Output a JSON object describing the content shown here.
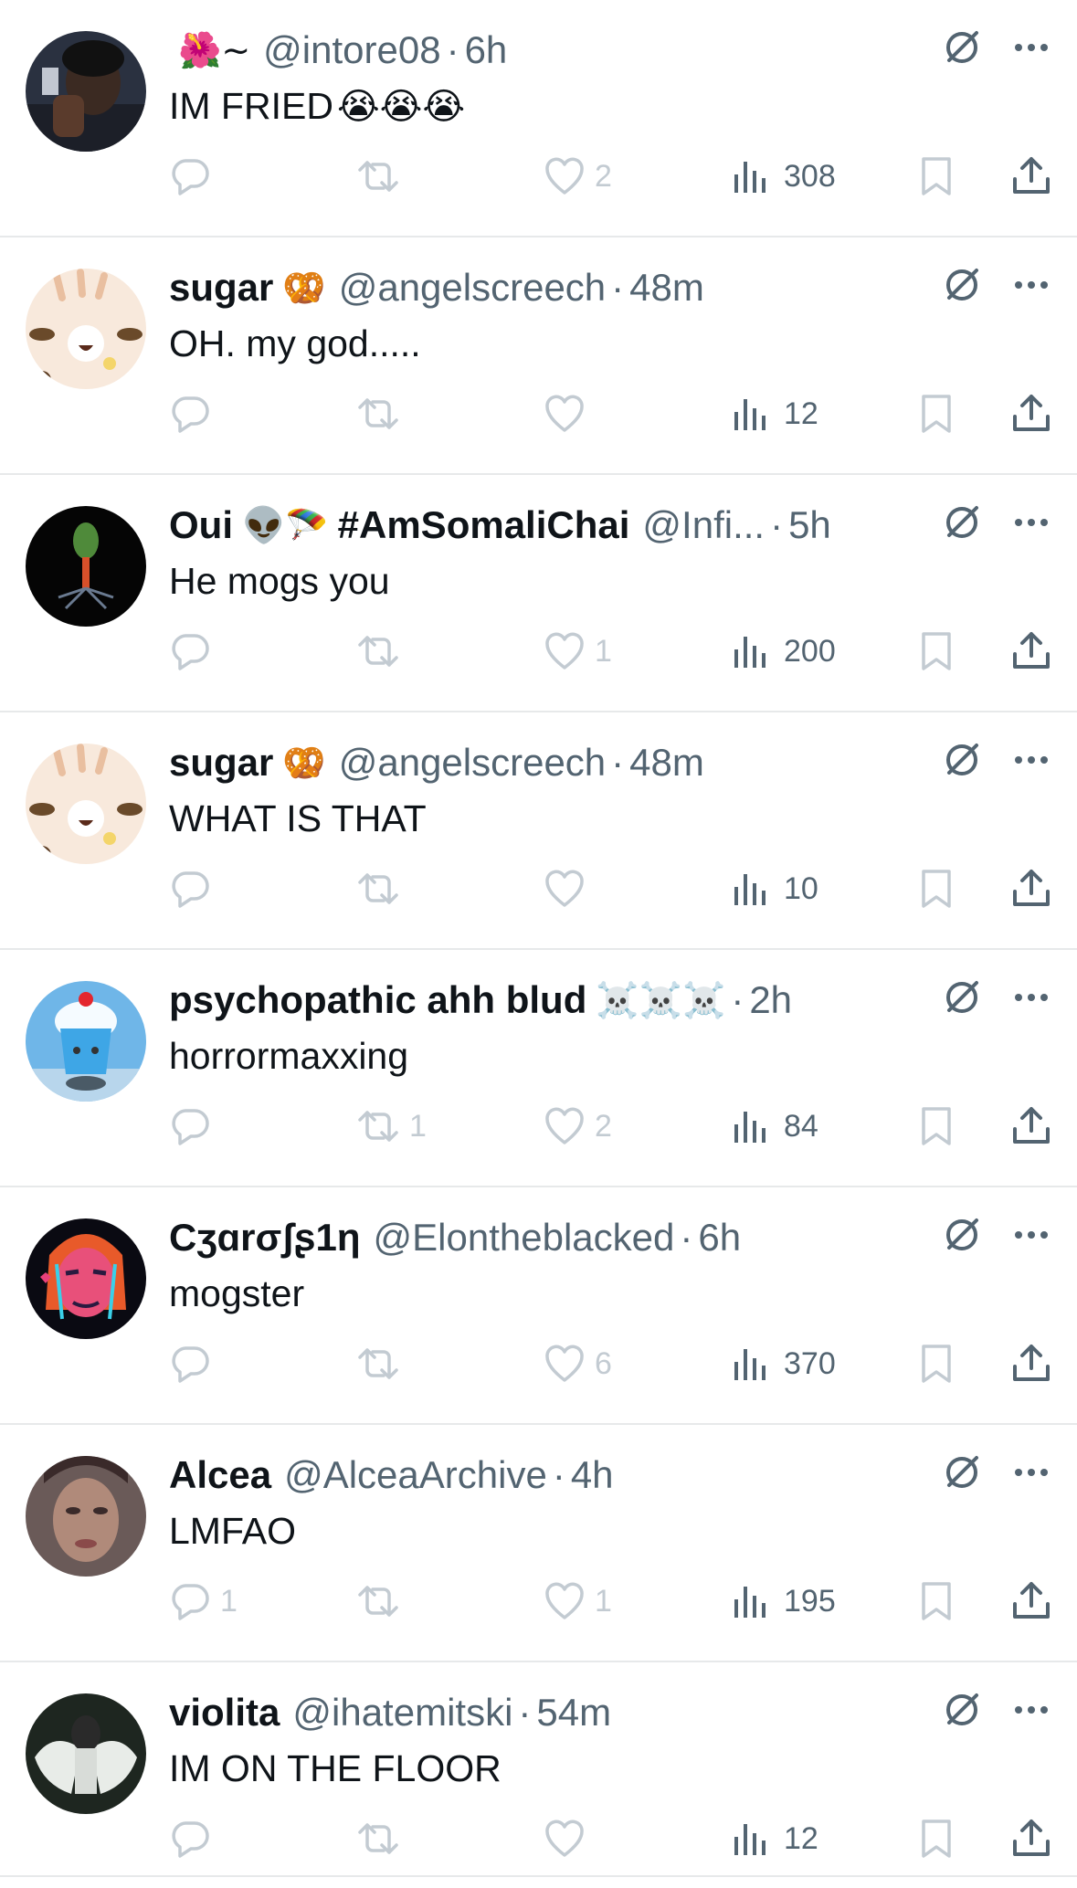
{
  "tweets": [
    {
      "name": "",
      "name_emoji": "🌺~",
      "handle": "@intore08",
      "time": "6h",
      "text": "IM FRIED",
      "text_emoji": "😭😭😭",
      "replies": "",
      "reposts": "",
      "likes": "2",
      "views": "308",
      "avatar": "dark-photo"
    },
    {
      "name": "sugar",
      "name_emoji": "🥨",
      "handle": "@angelscreech",
      "time": "48m",
      "text": "OH. my god.....",
      "text_emoji": "",
      "replies": "",
      "reposts": "",
      "likes": "",
      "views": "12",
      "avatar": "cream-cat"
    },
    {
      "name": "Oui",
      "name_emoji": "👽🪂",
      "name_suffix": "#AmSomaliChai",
      "handle": "@Infi...",
      "time": "5h",
      "text": "He mogs you",
      "text_emoji": "",
      "replies": "",
      "reposts": "",
      "likes": "1",
      "views": "200",
      "avatar": "black-virus"
    },
    {
      "name": "sugar",
      "name_emoji": "🥨",
      "handle": "@angelscreech",
      "time": "48m",
      "text": "WHAT IS THAT",
      "text_emoji": "",
      "replies": "",
      "reposts": "",
      "likes": "",
      "views": "10",
      "avatar": "cream-cat"
    },
    {
      "name": "psychopathic ahh blud",
      "name_emoji": "☠️☠️☠️",
      "handle": "",
      "time": "2h",
      "text": "horrormaxxing",
      "text_emoji": "",
      "replies": "",
      "reposts": "1",
      "likes": "2",
      "views": "84",
      "avatar": "blue-dessert"
    },
    {
      "name": "Cʒɑrσʃʂ1η",
      "name_emoji": "",
      "handle": "@Elontheblacked",
      "time": "6h",
      "text": "mogster",
      "text_emoji": "",
      "replies": "",
      "reposts": "",
      "likes": "6",
      "views": "370",
      "avatar": "neon-portrait"
    },
    {
      "name": "Alcea",
      "name_emoji": "",
      "handle": "@AlceaArchive",
      "time": "4h",
      "text": "LMFAO",
      "text_emoji": "",
      "replies": "1",
      "reposts": "",
      "likes": "1",
      "views": "195",
      "avatar": "blurry-face"
    },
    {
      "name": "violita",
      "name_emoji": "",
      "handle": "@ihatemitski",
      "time": "54m",
      "text": "IM ON THE FLOOR",
      "text_emoji": "",
      "replies": "",
      "reposts": "",
      "likes": "",
      "views": "12",
      "avatar": "angel-drawing"
    }
  ],
  "colors": {
    "text": "#0f1419",
    "secondary": "#536471",
    "muted_icon": "#c3cbd2",
    "divider": "#e7e9ea"
  },
  "icons": {
    "grok": "grok-icon",
    "more": "more-icon",
    "reply": "reply-icon",
    "repost": "repost-icon",
    "like": "heart-icon",
    "views": "views-icon",
    "bookmark": "bookmark-icon",
    "share": "share-icon"
  }
}
